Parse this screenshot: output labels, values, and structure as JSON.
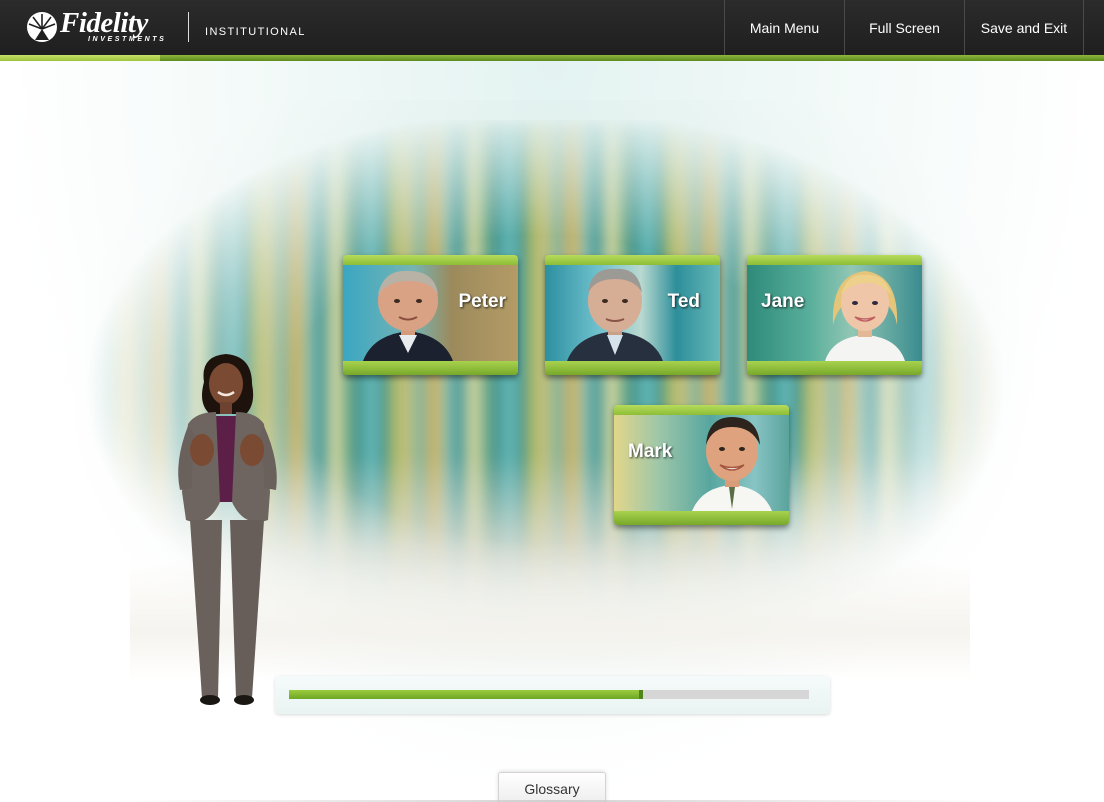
{
  "header": {
    "logo_word": "Fidelity",
    "logo_sub": "INVESTMENTS",
    "logo_tagline": "INSTITUTIONAL",
    "nav": [
      {
        "label": "Main Menu"
      },
      {
        "label": "Full Screen"
      },
      {
        "label": "Save and Exit"
      }
    ]
  },
  "characters": [
    {
      "name": "Peter"
    },
    {
      "name": "Ted"
    },
    {
      "name": "Jane"
    },
    {
      "name": "Mark"
    }
  ],
  "progress": {
    "fraction": 0.68
  },
  "footer": {
    "glossary_label": "Glossary"
  },
  "colors": {
    "header_bg": "#1f1f1f",
    "accent_green": "#8cc03a",
    "progress_fill": "#7fb52e",
    "progress_track": "#d6d6d6"
  },
  "icons": {
    "logo_mark": "fidelity-pyramid-burst-icon"
  }
}
